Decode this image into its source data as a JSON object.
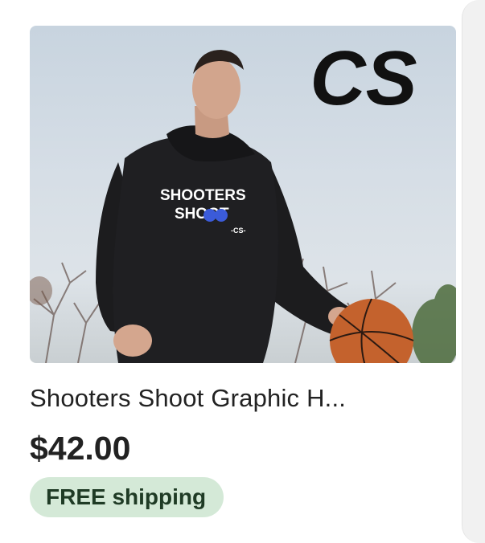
{
  "listing": {
    "title": "Shooters Shoot Graphic H...",
    "price": "$42.00",
    "shipping_badge": "FREE shipping"
  },
  "image": {
    "logo_text": "CS",
    "shirt_print": {
      "line1": "SHOOTERS",
      "line2": "SHOOT",
      "tag": "-CS-"
    }
  },
  "colors": {
    "badge_background": "#d4e9d7",
    "text": "#222222",
    "hoodie": "#1c1c1e",
    "basketball": "#c4622d",
    "shirt_print_accent": "#3b5bd9"
  }
}
